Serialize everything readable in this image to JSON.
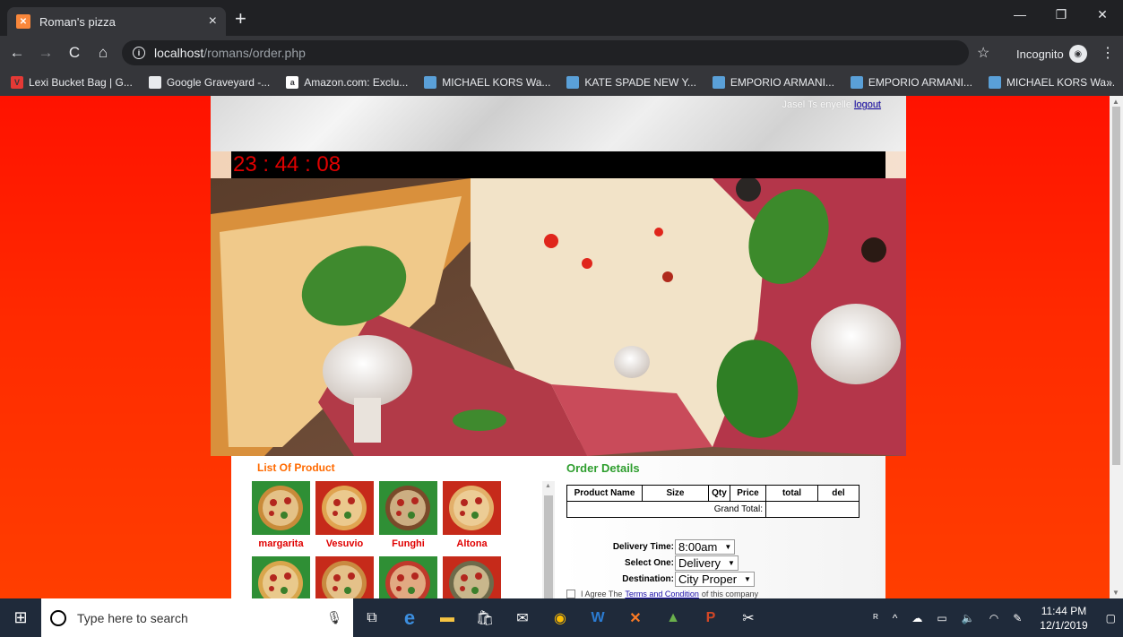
{
  "browser": {
    "tab_title": "Roman's pizza",
    "tab_close": "×",
    "new_tab": "+",
    "url_host": "localhost",
    "url_path": "/romans/order.php",
    "incognito_label": "Incognito",
    "bookmarks": [
      {
        "label": "Lexi Bucket Bag | G...",
        "icon": "v-icon",
        "color": "#e53935"
      },
      {
        "label": "Google Graveyard -...",
        "icon": "ghost-icon",
        "color": "#e8eaed"
      },
      {
        "label": "Amazon.com: Exclu...",
        "icon": "amazon-icon",
        "color": "#ffffff"
      },
      {
        "label": "MICHAEL KORS Wa...",
        "icon": "bookmark-page-icon",
        "color": "#5aa0d8"
      },
      {
        "label": "KATE SPADE NEW Y...",
        "icon": "bookmark-page-icon",
        "color": "#5aa0d8"
      },
      {
        "label": "EMPORIO ARMANI...",
        "icon": "bookmark-page-icon",
        "color": "#5aa0d8"
      },
      {
        "label": "EMPORIO ARMANI...",
        "icon": "bookmark-page-icon",
        "color": "#5aa0d8"
      },
      {
        "label": "MICHAEL KORS Wa...",
        "icon": "bookmark-page-icon",
        "color": "#5aa0d8"
      }
    ],
    "bookmarks_more": "»"
  },
  "page": {
    "user_text": "Jasel Ts enyelle",
    "logout_label": "logout",
    "clock": "23 : 44 : 08",
    "products_title": "List Of Product",
    "products": [
      {
        "name": "margarita"
      },
      {
        "name": "Vesuvio"
      },
      {
        "name": "Funghi"
      },
      {
        "name": "Altona"
      },
      {
        "name": ""
      },
      {
        "name": ""
      },
      {
        "name": ""
      },
      {
        "name": ""
      }
    ],
    "order_title": "Order Details",
    "table_headers": [
      "Product Name",
      "Size",
      "Qty",
      "Price",
      "total",
      "del"
    ],
    "grand_total_label": "Grand Total:",
    "delivery_time_label": "Delivery Time:",
    "delivery_time_value": "8:00am",
    "select_one_label": "Select One:",
    "select_one_value": "Delivery",
    "destination_label": "Destination:",
    "destination_value": "City Proper",
    "agree_prefix": "I Agree The",
    "agree_link": "Terms and Condition",
    "agree_suffix": "of this company"
  },
  "taskbar": {
    "search_placeholder": "Type here to search",
    "time": "11:44 PM",
    "date": "12/1/2019"
  },
  "colors": {
    "page_bg": "#ff2a00",
    "clock_text": "#e00000",
    "product_title": "#ff6a00",
    "order_title": "#2e9e2e"
  }
}
